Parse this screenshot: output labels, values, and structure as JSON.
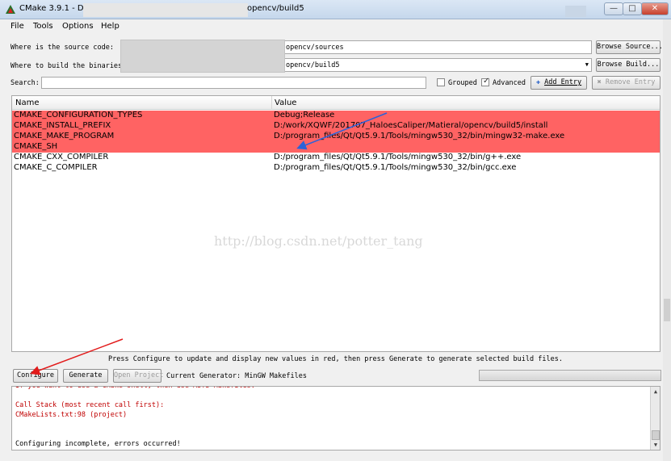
{
  "window": {
    "title_prefix": "CMake 3.9.1 - D:/",
    "title_suffix": "opencv/build5",
    "minimize_glyph": "—",
    "maximize_glyph": "□",
    "close_glyph": "✕"
  },
  "menu": {
    "file": "File",
    "tools": "Tools",
    "options": "Options",
    "help": "Help"
  },
  "source": {
    "label": "Where is the source code:",
    "value": "opencv/sources",
    "browse_label": "Browse Source..."
  },
  "build": {
    "label": "Where to build the binaries:",
    "value": "opencv/build5",
    "browse_label": "Browse Build..."
  },
  "search": {
    "label": "Search:",
    "value": "",
    "grouped_label": "Grouped",
    "grouped_checked": false,
    "advanced_label": "Advanced",
    "advanced_checked": true,
    "add_entry_label": "Add Entry",
    "remove_entry_label": "Remove Entry"
  },
  "table": {
    "col_name": "Name",
    "col_value": "Value",
    "rows": [
      {
        "name": "CMAKE_CONFIGURATION_TYPES",
        "value": "Debug;Release",
        "highlight": true
      },
      {
        "name": "CMAKE_INSTALL_PREFIX",
        "value": "D:/work/XQWF/201707_HaloesCaliper/Matieral/opencv/build5/install",
        "highlight": true
      },
      {
        "name": "CMAKE_MAKE_PROGRAM",
        "value": "D:/program_files/Qt/Qt5.9.1/Tools/mingw530_32/bin/mingw32-make.exe",
        "highlight": true
      },
      {
        "name": "CMAKE_SH",
        "value": "",
        "highlight": true
      },
      {
        "name": "CMAKE_CXX_COMPILER",
        "value": "D:/program_files/Qt/Qt5.9.1/Tools/mingw530_32/bin/g++.exe",
        "highlight": false
      },
      {
        "name": "CMAKE_C_COMPILER",
        "value": "D:/program_files/Qt/Qt5.9.1/Tools/mingw530_32/bin/gcc.exe",
        "highlight": false
      }
    ],
    "watermark": "http://blog.csdn.net/potter_tang"
  },
  "bottom": {
    "hint": "Press Configure to update and display new values in red, then press Generate to generate selected build files.",
    "configure_label": "Configure",
    "generate_label": "Generate",
    "open_project_label": "Open Project",
    "generator_text": "Current Generator: MinGW Makefiles",
    "progress": 0
  },
  "output": {
    "lines": [
      {
        "text": "  If you want to use a CMake shell, then use MSYS Makefiles.",
        "red": true
      },
      {
        "text": "",
        "red": false
      },
      {
        "text": "Call Stack (most recent call first):",
        "red": true
      },
      {
        "text": "  CMakeLists.txt:98 (project)",
        "red": true
      },
      {
        "text": "",
        "red": false
      },
      {
        "text": "",
        "red": false
      },
      {
        "text": "Configuring incomplete, errors occurred!",
        "red": false
      }
    ]
  },
  "colors": {
    "highlight_row": "#ff6363",
    "annotation_arrow": "#e21b1b",
    "annotation_arrow_blue": "#2b63d9"
  }
}
